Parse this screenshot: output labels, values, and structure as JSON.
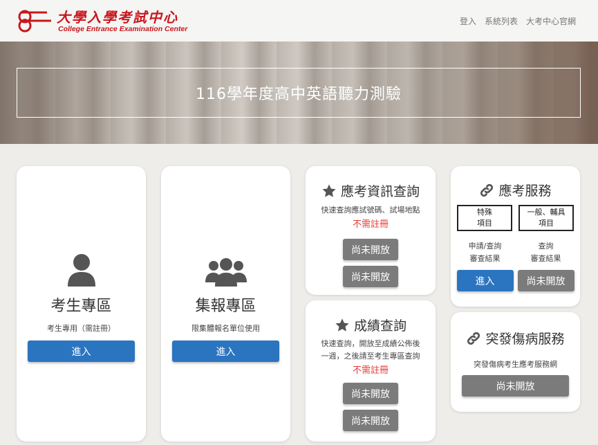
{
  "header": {
    "logo_zh": "大學入學考試中心",
    "logo_en": "College Entrance Examination Center",
    "nav": [
      "登入",
      "系統列表",
      "大考中心官網"
    ]
  },
  "banner": {
    "title": "116學年度高中英語聽力測驗"
  },
  "student_card": {
    "title": "考生專區",
    "desc": "考生專用（需註冊）",
    "button": "進入"
  },
  "group_card": {
    "title": "集報專區",
    "desc": "限集體報名單位使用",
    "button": "進入"
  },
  "exam_info": {
    "title": "應考資訊查詢",
    "desc": "快速查詢應試號碼、試場地點",
    "note": "不需註冊",
    "buttons": [
      "尚未開放",
      "尚未開放"
    ]
  },
  "score": {
    "title": "成績查詢",
    "desc_line1": "快速查詢，開放至成績公佈後",
    "desc_line2": "一週，之後請至考生專區查詢",
    "note": "不需註冊",
    "buttons": [
      "尚未開放",
      "尚未開放"
    ]
  },
  "service": {
    "title": "應考服務",
    "box_special_l1": "特殊",
    "box_special_l2": "項目",
    "box_general_l1": "一般、輔具",
    "box_general_l2": "項目",
    "label_left_l1": "申請/查詢",
    "label_left_l2": "審查結果",
    "label_right_l1": "查詢",
    "label_right_l2": "審查結果",
    "btn_left": "進入",
    "btn_right": "尚未開放"
  },
  "emergency": {
    "title": "突發傷病服務",
    "desc": "突發傷病考生應考服務網",
    "button": "尚未開放"
  },
  "colors": {
    "brand_red": "#c8161d",
    "primary_blue": "#2b74c0",
    "disabled_gray": "#7b7b7b",
    "note_red": "#e53935"
  },
  "icons": [
    "user-icon",
    "users-icon",
    "star-icon",
    "link-icon"
  ]
}
